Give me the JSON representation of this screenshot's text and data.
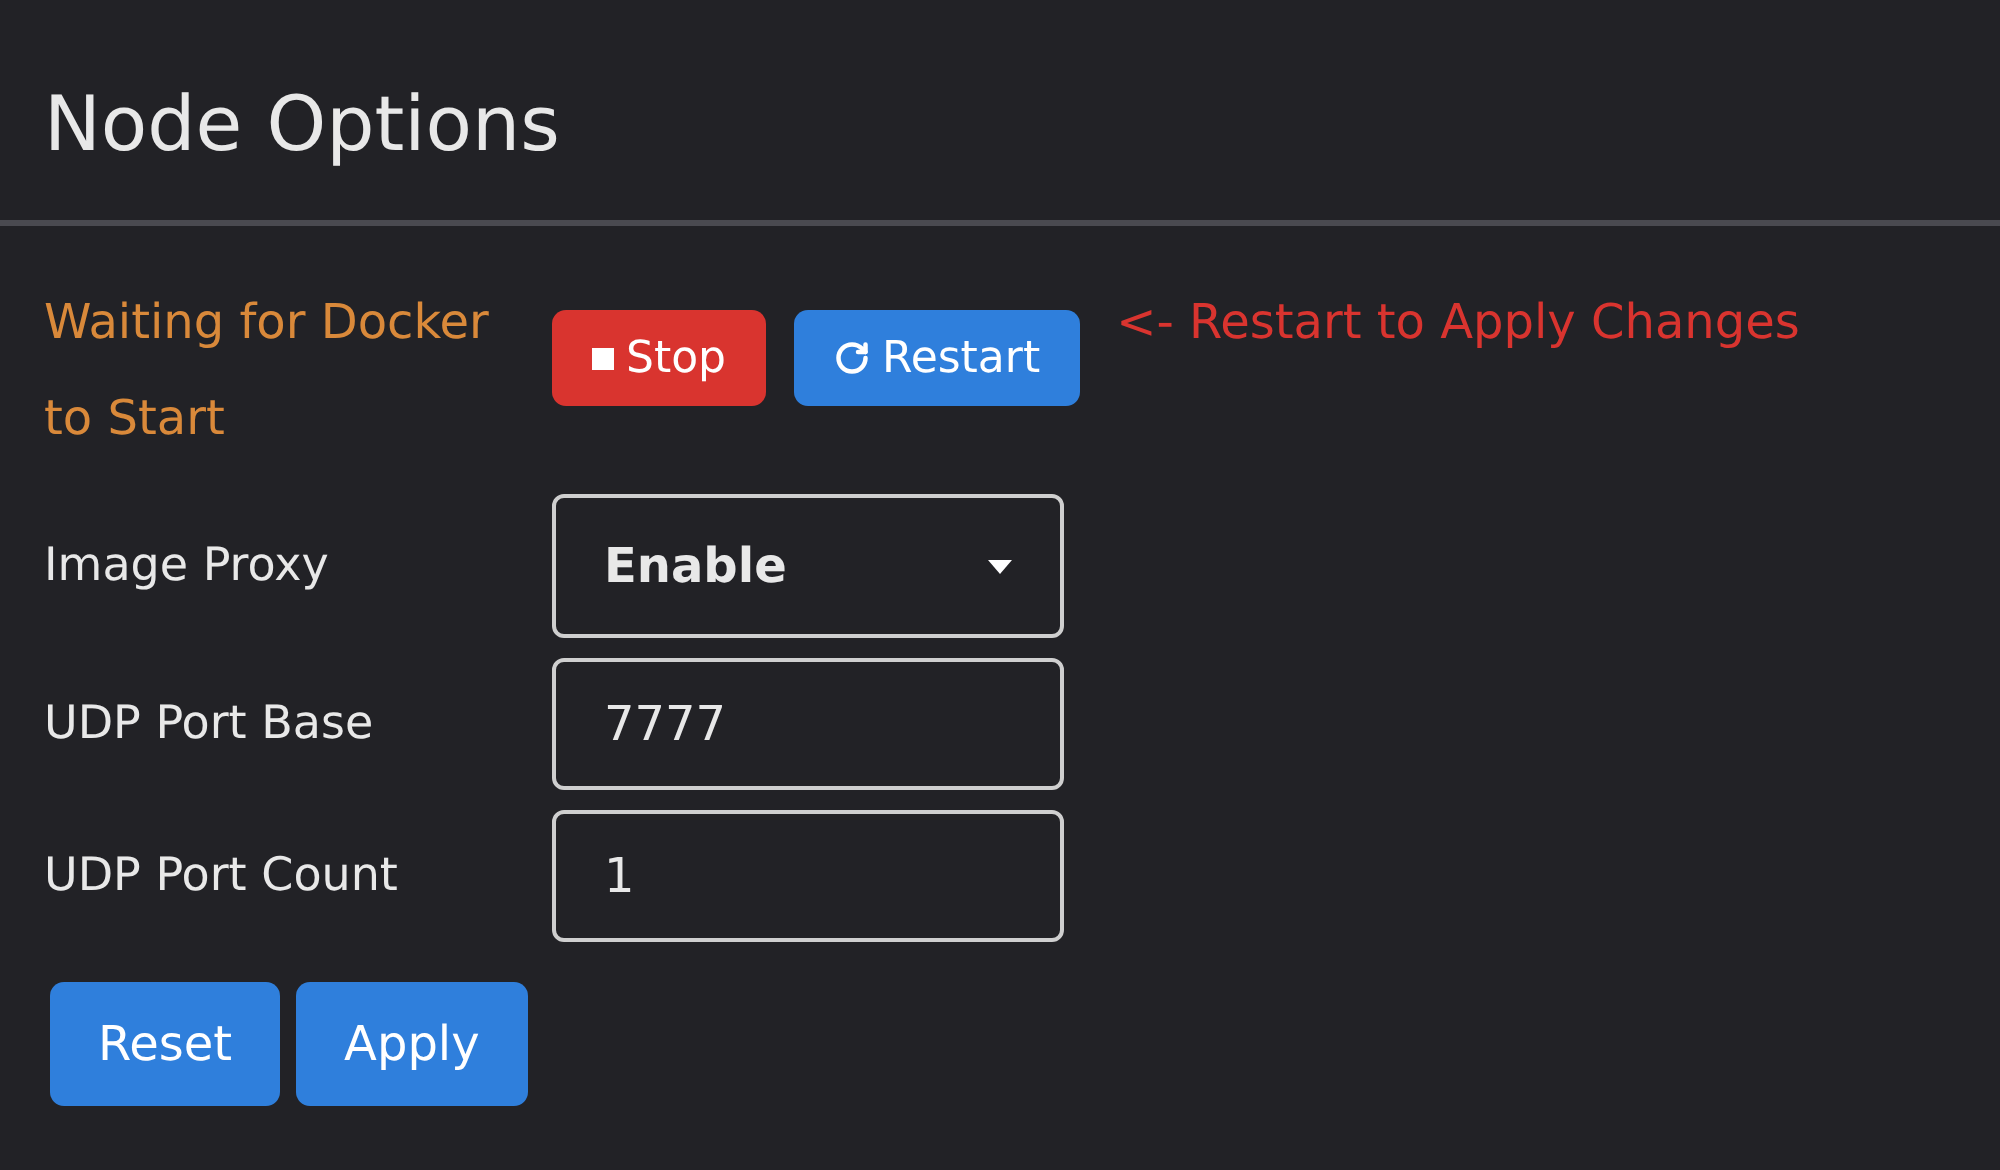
{
  "title": "Node Options",
  "status": "Waiting for Docker to Start",
  "controls": [
    {
      "kind": "stop",
      "label": "Stop"
    },
    {
      "kind": "restart",
      "label": "Restart"
    }
  ],
  "hint": "<- Restart to Apply Changes",
  "fields": [
    {
      "label": "Image Proxy",
      "kind": "select",
      "value": "Enable"
    },
    {
      "label": "UDP Port Base",
      "kind": "input",
      "value": "7777"
    },
    {
      "label": "UDP Port Count",
      "kind": "input",
      "value": "1"
    }
  ],
  "actions": [
    "Reset",
    "Apply"
  ]
}
